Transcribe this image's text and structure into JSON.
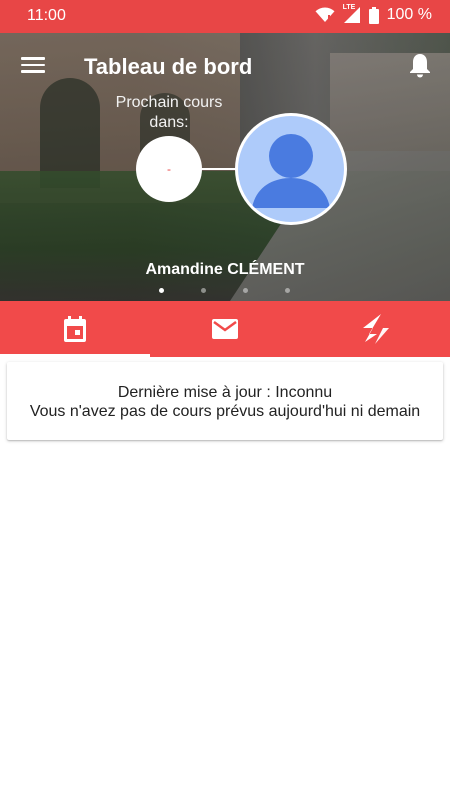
{
  "status_bar": {
    "time": "11:00",
    "network": "LTE",
    "battery": "100 %"
  },
  "header": {
    "title": "Tableau de bord"
  },
  "next_course": {
    "label": "Prochain cours dans:",
    "countdown": "-"
  },
  "profile": {
    "name": "Amandine CLÉMENT"
  },
  "carousel": {
    "page_count": 4,
    "active_index": 0
  },
  "tabs": [
    {
      "icon": "calendar-icon",
      "active": true
    },
    {
      "icon": "mail-icon",
      "active": false
    },
    {
      "icon": "lightning-icon",
      "active": false
    }
  ],
  "card": {
    "last_update": "Dernière mise à jour : Inconnu",
    "message": "Vous n'avez pas de cours prévus aujourd'hui ni demain"
  },
  "colors": {
    "accent": "#f14a4a",
    "status_bar": "#e84646",
    "avatar_bg": "#aecbfa",
    "avatar_fg": "#4a7be0"
  }
}
